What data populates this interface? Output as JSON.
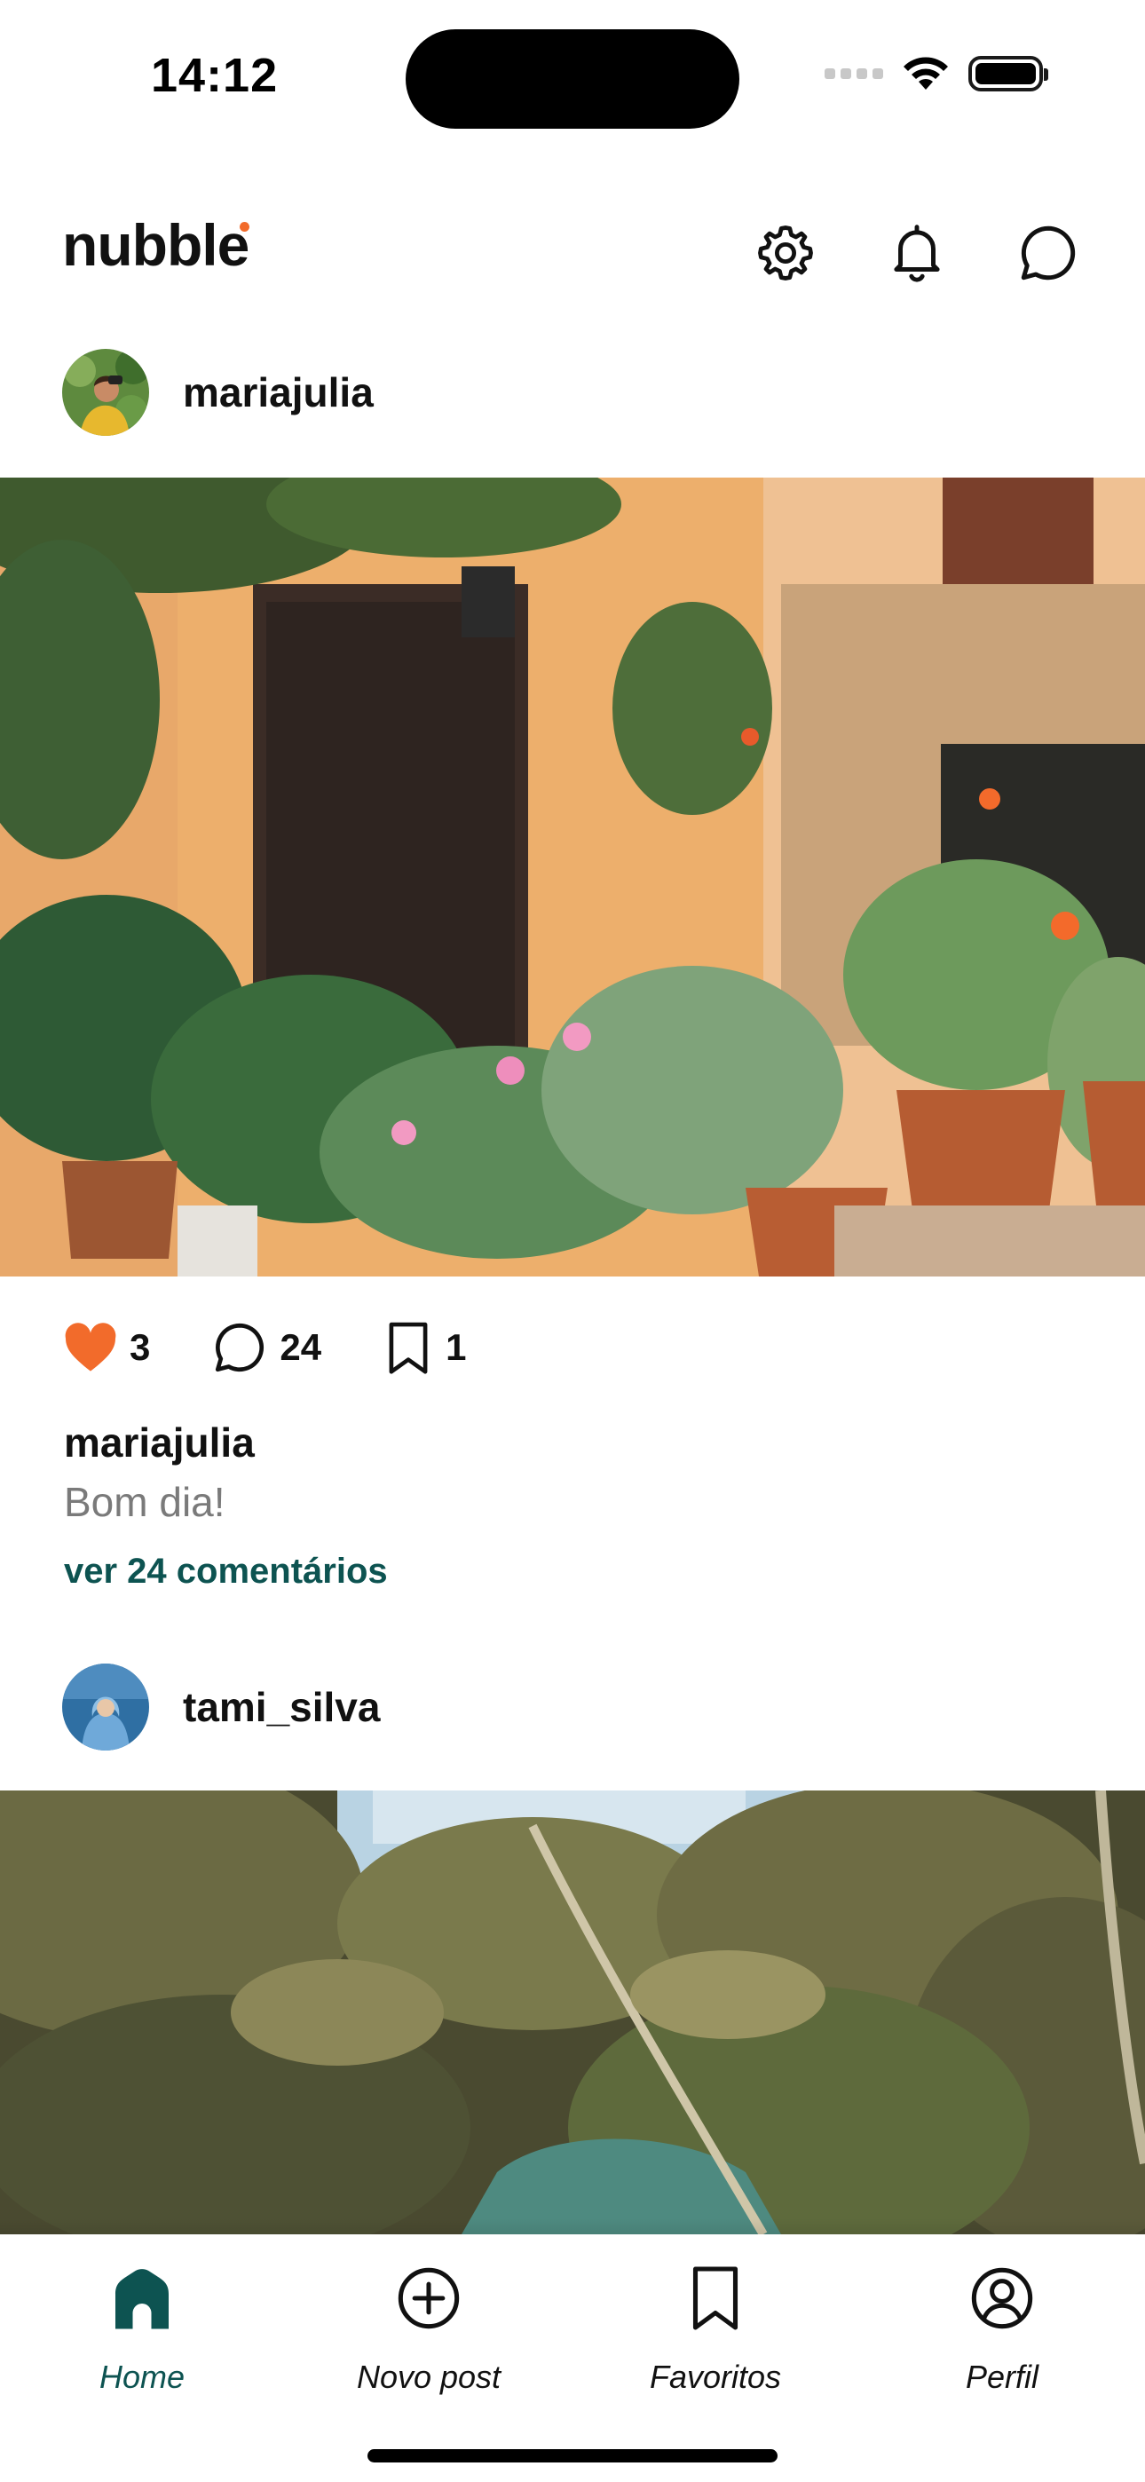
{
  "status_bar": {
    "time": "14:12"
  },
  "header": {
    "logo": "nubble",
    "logo_dot_color": "#F26B2B",
    "actions": [
      {
        "name": "settings",
        "icon": "gear-icon"
      },
      {
        "name": "notifications",
        "icon": "bell-icon"
      },
      {
        "name": "messages",
        "icon": "chat-bubble-icon"
      }
    ]
  },
  "feed": {
    "posts": [
      {
        "author": "mariajulia",
        "avatar_icon": "avatar-woman-photographer",
        "image": "house-facade-with-potted-plants",
        "likes": "3",
        "comments": "24",
        "favorites": "1",
        "liked": true,
        "caption_author": "mariajulia",
        "caption": "Bom dia!",
        "comments_link": "ver 24 comentários"
      },
      {
        "author": "tami_silva",
        "avatar_icon": "avatar-woman-in-blue-hoodie",
        "image": "palm-trees-over-river"
      }
    ]
  },
  "tab_bar": {
    "tabs": [
      {
        "label": "Home",
        "icon": "home-icon",
        "active": true
      },
      {
        "label": "Novo post",
        "icon": "plus-circle-icon",
        "active": false
      },
      {
        "label": "Favoritos",
        "icon": "bookmark-icon",
        "active": false
      },
      {
        "label": "Perfil",
        "icon": "profile-icon",
        "active": false
      }
    ]
  },
  "colors": {
    "brand_primary": "#0D5351",
    "like_heart": "#F26B2B",
    "text_primary": "#111111",
    "text_secondary": "#7A7A7A"
  }
}
